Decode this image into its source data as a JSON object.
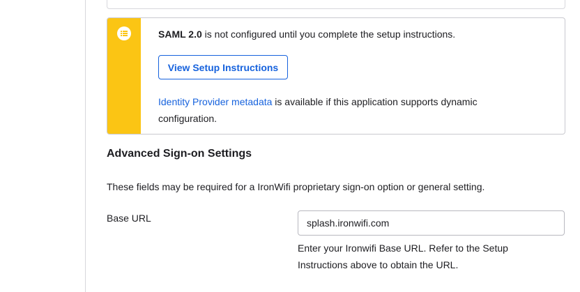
{
  "callout": {
    "icon": "list-icon",
    "accent_color": "#fbc514",
    "saml_label": "SAML 2.0",
    "saml_text": " is not configured until you complete the setup instructions.",
    "button_label": "View Setup Instructions",
    "metadata_link": "Identity Provider metadata",
    "metadata_text": " is available if this application supports dynamic configuration."
  },
  "advanced": {
    "title": "Advanced Sign-on Settings",
    "description": "These fields may be required for a IronWifi proprietary sign-on option or general setting.",
    "base_url": {
      "label": "Base URL",
      "value": "splash.ironwifi.com",
      "help": "Enter your Ironwifi Base URL. Refer to the Setup Instructions above to obtain the URL."
    }
  },
  "colors": {
    "link": "#1662dd",
    "accent": "#fbc514"
  }
}
